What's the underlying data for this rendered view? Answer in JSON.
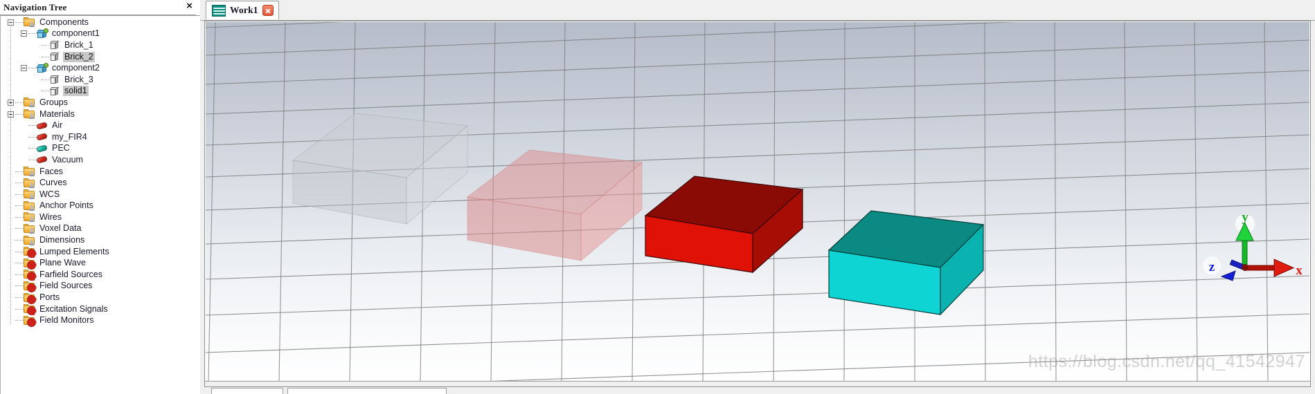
{
  "navigation_panel": {
    "title": "Navigation Tree",
    "close_label": "×",
    "tree": [
      {
        "label": "Components",
        "depth": 0,
        "icon": "folder-cone-icon",
        "expander": "minus",
        "selected": false
      },
      {
        "label": "component1",
        "depth": 1,
        "icon": "component-cube-icon",
        "expander": "minus",
        "selected": false
      },
      {
        "label": "Brick_1",
        "depth": 2,
        "icon": "brick-cube-icon",
        "expander": "none",
        "selected": false
      },
      {
        "label": "Brick_2",
        "depth": 2,
        "icon": "brick-cube-icon",
        "expander": "none",
        "selected": true
      },
      {
        "label": "component2",
        "depth": 1,
        "icon": "component-cube-icon",
        "expander": "minus",
        "selected": false
      },
      {
        "label": "Brick_3",
        "depth": 2,
        "icon": "brick-cube-icon",
        "expander": "none",
        "selected": false
      },
      {
        "label": "solid1",
        "depth": 2,
        "icon": "brick-cube-icon",
        "expander": "none",
        "selected": true
      },
      {
        "label": "Groups",
        "depth": 0,
        "icon": "folder-cone-icon",
        "expander": "plus",
        "selected": false
      },
      {
        "label": "Materials",
        "depth": 0,
        "icon": "folder-cone-icon",
        "expander": "minus",
        "selected": false
      },
      {
        "label": "Air",
        "depth": 1,
        "icon": "material-red-icon",
        "expander": "none",
        "selected": false
      },
      {
        "label": "my_FIR4",
        "depth": 1,
        "icon": "material-red-icon",
        "expander": "none",
        "selected": false
      },
      {
        "label": "PEC",
        "depth": 1,
        "icon": "material-teal-icon",
        "expander": "none",
        "selected": false
      },
      {
        "label": "Vacuum",
        "depth": 1,
        "icon": "material-red-icon",
        "expander": "none",
        "selected": false
      },
      {
        "label": "Faces",
        "depth": 0,
        "icon": "folder-cone-icon",
        "expander": "none",
        "selected": false
      },
      {
        "label": "Curves",
        "depth": 0,
        "icon": "folder-cone-icon",
        "expander": "none",
        "selected": false
      },
      {
        "label": "WCS",
        "depth": 0,
        "icon": "folder-cone-icon",
        "expander": "none",
        "selected": false
      },
      {
        "label": "Anchor Points",
        "depth": 0,
        "icon": "folder-cone-icon",
        "expander": "none",
        "selected": false
      },
      {
        "label": "Wires",
        "depth": 0,
        "icon": "folder-cone-icon",
        "expander": "none",
        "selected": false
      },
      {
        "label": "Voxel Data",
        "depth": 0,
        "icon": "folder-cone-icon",
        "expander": "none",
        "selected": false
      },
      {
        "label": "Dimensions",
        "depth": 0,
        "icon": "folder-cone-icon",
        "expander": "none",
        "selected": false
      },
      {
        "label": "Lumped Elements",
        "depth": 0,
        "icon": "folder-gear-icon",
        "expander": "none",
        "selected": false
      },
      {
        "label": "Plane Wave",
        "depth": 0,
        "icon": "folder-gear-icon",
        "expander": "none",
        "selected": false
      },
      {
        "label": "Farfield Sources",
        "depth": 0,
        "icon": "folder-gear-icon",
        "expander": "none",
        "selected": false
      },
      {
        "label": "Field Sources",
        "depth": 0,
        "icon": "folder-gear-icon",
        "expander": "none",
        "selected": false
      },
      {
        "label": "Ports",
        "depth": 0,
        "icon": "folder-gear-icon",
        "expander": "none",
        "selected": false
      },
      {
        "label": "Excitation Signals",
        "depth": 0,
        "icon": "folder-gear-icon",
        "expander": "none",
        "selected": false
      },
      {
        "label": "Field Monitors",
        "depth": 0,
        "icon": "folder-gear-icon",
        "expander": "none",
        "selected": false
      }
    ]
  },
  "tabbar": {
    "tab": {
      "label": "Work1",
      "icon": "wave-document-icon",
      "close_label": "×",
      "active": true
    }
  },
  "viewport": {
    "watermark": "https://blog.csdn.net/qq_41542947",
    "axis_gizmo": {
      "x_label": "x",
      "x_color": "#e01b10",
      "y_label": "y",
      "y_color": "#16ad2a",
      "z_label": "z",
      "z_color": "#1420d8"
    },
    "objects": [
      {
        "name": "Brick_1",
        "style": "transparent-gray",
        "top_color": "#c4c7cc",
        "front_color": "#c9ccd1",
        "side_color": "#b6babf",
        "opacity": 0.45
      },
      {
        "name": "Brick_2",
        "style": "transparent-pink",
        "top_color": "#e09a9a",
        "front_color": "#e3a0a0",
        "side_color": "#cf8a8a",
        "opacity": 0.55
      },
      {
        "name": "Brick_3",
        "style": "solid-red",
        "top_color": "#8c0b05",
        "front_color": "#e01208",
        "side_color": "#a90d05",
        "opacity": 1
      },
      {
        "name": "solid1",
        "style": "solid-teal",
        "top_color": "#0a8a83",
        "front_color": "#0fd4d4",
        "side_color": "#0aa8a8",
        "opacity": 1
      }
    ],
    "grid": {
      "visible": true,
      "line_color": "#808080"
    }
  }
}
